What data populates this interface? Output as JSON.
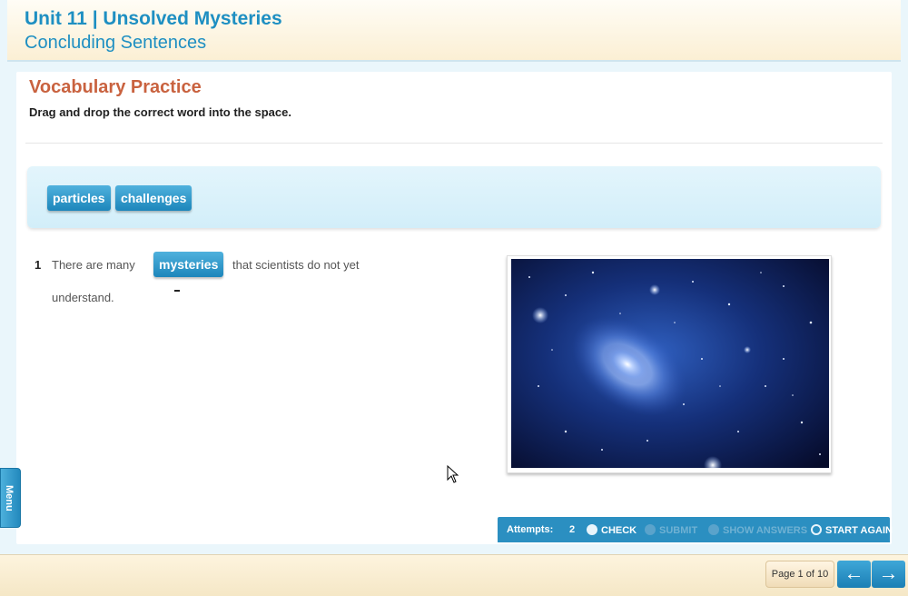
{
  "header": {
    "unit_title": "Unit 11 | Unsolved Mysteries",
    "lesson_title": "Concluding Sentences"
  },
  "activity": {
    "title": "Vocabulary Practice",
    "instruction": "Drag and drop the correct word into the space."
  },
  "word_bank": {
    "words": [
      "particles",
      "challenges"
    ]
  },
  "question": {
    "number": "1",
    "text_before": "There are many",
    "placed_word": "mysteries",
    "text_after": "that scientists do not yet",
    "text_line2": "understand."
  },
  "image": {
    "icon": "galaxy-space-image"
  },
  "toolbar": {
    "attempts_label": "Attempts:",
    "attempts_value": "2",
    "check_label": "CHECK",
    "submit_label": "SUBMIT",
    "show_answers_label": "SHOW ANSWERS",
    "start_again_label": "START AGAIN"
  },
  "sidebar": {
    "menu_label": "Menu"
  },
  "footer": {
    "page_indicator": "Page 1 of 10",
    "prev_icon": "←",
    "next_icon": "→"
  },
  "colors": {
    "accent_blue": "#1e8fc2",
    "title_orange": "#c9623f",
    "toolbar_blue": "#2b8fc1"
  }
}
